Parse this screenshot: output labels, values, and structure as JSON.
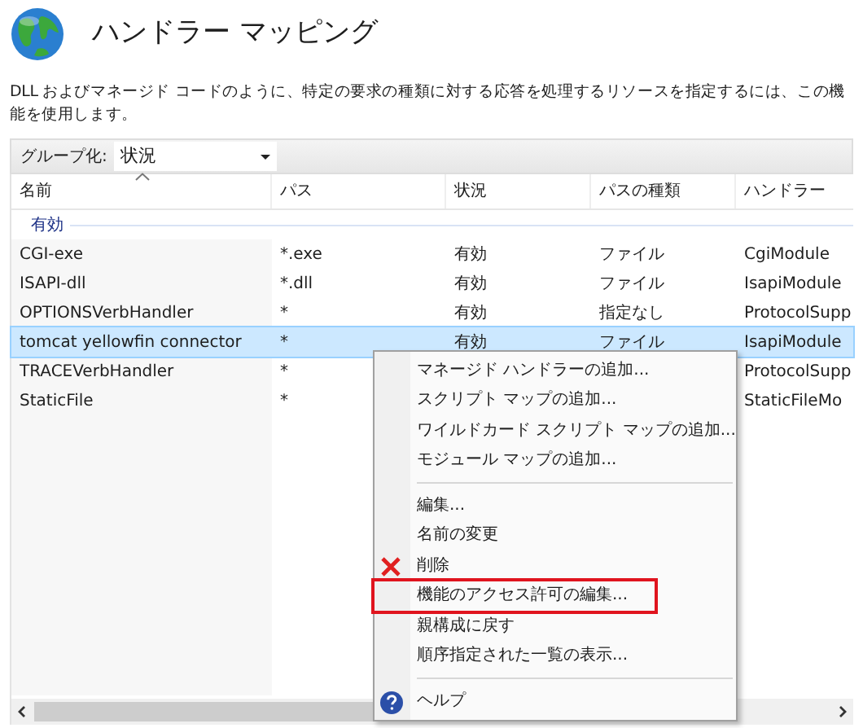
{
  "title": "ハンドラー マッピング",
  "description": "DLL およびマネージド コードのように、特定の要求の種類に対する応答を処理するリソースを指定するには、この機能を使用します。",
  "group_by": {
    "label": "グループ化:",
    "value": "状況"
  },
  "table": {
    "columns": [
      {
        "label": "名前",
        "sorted": true
      },
      {
        "label": "パス",
        "sorted": false
      },
      {
        "label": "状況",
        "sorted": false
      },
      {
        "label": "パスの種類",
        "sorted": false
      },
      {
        "label": "ハンドラー",
        "sorted": false
      }
    ],
    "group": "有効",
    "rows": [
      {
        "name": "CGI-exe",
        "path": "*.exe",
        "status": "有効",
        "path_type": "ファイル",
        "handler": "CgiModule",
        "selected": false
      },
      {
        "name": "ISAPI-dll",
        "path": "*.dll",
        "status": "有効",
        "path_type": "ファイル",
        "handler": "IsapiModule",
        "selected": false
      },
      {
        "name": "OPTIONSVerbHandler",
        "path": "*",
        "status": "有効",
        "path_type": "指定なし",
        "handler": "ProtocolSupp",
        "selected": false
      },
      {
        "name": "tomcat yellowfin connector",
        "path": "*",
        "status": "有効",
        "path_type": "ファイル",
        "handler": "IsapiModule",
        "selected": true
      },
      {
        "name": "TRACEVerbHandler",
        "path": "*",
        "handler": "ProtocolSupp",
        "selected": false
      },
      {
        "name": "StaticFile",
        "path": "*",
        "handler": "StaticFileMo",
        "selected": false
      }
    ]
  },
  "context_menu": [
    {
      "kind": "plain",
      "label": "マネージド ハンドラーの追加...",
      "highlighted": false
    },
    {
      "kind": "plain",
      "label": "スクリプト マップの追加...",
      "highlighted": false
    },
    {
      "kind": "plain",
      "label": "ワイルドカード スクリプト マップの追加...",
      "highlighted": false
    },
    {
      "kind": "plain",
      "label": "モジュール マップの追加...",
      "highlighted": false
    },
    {
      "kind": "separator"
    },
    {
      "kind": "plain",
      "label": "編集...",
      "highlighted": false
    },
    {
      "kind": "plain",
      "label": "名前の変更",
      "highlighted": false
    },
    {
      "kind": "delete",
      "label": "削除",
      "highlighted": false
    },
    {
      "kind": "plain",
      "label": "機能のアクセス許可の編集...",
      "highlighted": true
    },
    {
      "kind": "plain",
      "label": "親構成に戻す",
      "highlighted": false
    },
    {
      "kind": "plain",
      "label": "順序指定された一覧の表示...",
      "highlighted": false
    },
    {
      "kind": "separator"
    },
    {
      "kind": "help",
      "label": "ヘルプ",
      "highlighted": false
    }
  ]
}
